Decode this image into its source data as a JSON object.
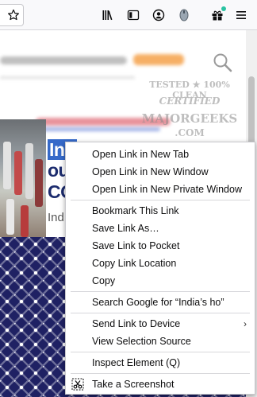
{
  "toolbar": {
    "icons": [
      "star-icon",
      "library-icon",
      "sidebar-icon",
      "account-icon",
      "extension-icon",
      "gift-icon",
      "hamburger-menu-icon"
    ]
  },
  "watermark": {
    "line1": "TESTED ★ 100% CLEAN",
    "line2": "CERTIFIED",
    "line3": "MAJORGEEKS",
    "line4": ".COM"
  },
  "article": {
    "headline_line1": "Ind",
    "headline_line2": "ou",
    "headline_line3": "CO",
    "snippet": "Ind"
  },
  "context_menu": {
    "items": [
      "Open Link in New Tab",
      "Open Link in New Window",
      "Open Link in New Private Window",
      "Bookmark This Link",
      "Save Link As…",
      "Save Link to Pocket",
      "Copy Link Location",
      "Copy",
      "Search Google for “India’s ho”",
      "Send Link to Device",
      "View Selection Source",
      "Inspect Element (Q)",
      "Take a Screenshot"
    ],
    "submenu_arrow": "›"
  },
  "colors": {
    "menu_bg": "#ffffff",
    "selection": "#3569c9",
    "pattern_bg": "#1f2163",
    "headline": "#1c2c6e"
  }
}
